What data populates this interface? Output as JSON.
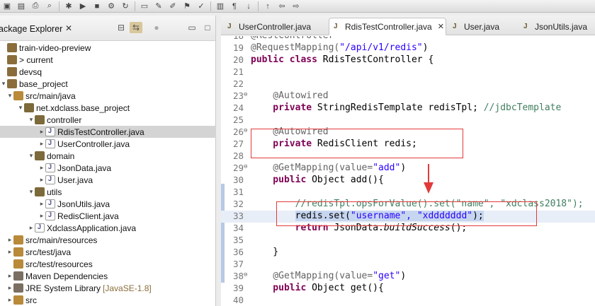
{
  "toolbar": {
    "icons": [
      "save-icon",
      "save-all-icon",
      "print-icon",
      "search-icon",
      "debug-icon",
      "run-icon",
      "stop-icon",
      "build-icon",
      "refresh-icon",
      "open-folder-icon",
      "edit-icon",
      "pencil-icon",
      "filter-icon",
      "highlight-icon",
      "layout-icon",
      "paragraph-icon",
      "navigate-down-icon",
      "navigate-up-icon",
      "back-icon",
      "forward-icon"
    ]
  },
  "explorer": {
    "title": "ackage Explorer",
    "close_glyph": "✕",
    "tree": [
      {
        "label": "train-video-preview",
        "indent": 0,
        "twisty": "",
        "icon": "project",
        "suffix": ""
      },
      {
        "label": "> current",
        "indent": 0,
        "twisty": "",
        "icon": "project",
        "suffix": ""
      },
      {
        "label": "devsq",
        "indent": 0,
        "twisty": "",
        "icon": "project",
        "suffix": ""
      },
      {
        "label": "base_project",
        "indent": 0,
        "twisty": "▾",
        "icon": "project",
        "suffix": ""
      },
      {
        "label": "src/main/java",
        "indent": 1,
        "twisty": "▾",
        "icon": "folder-src",
        "suffix": ""
      },
      {
        "label": "net.xdclass.base_project",
        "indent": 2,
        "twisty": "▾",
        "icon": "pkg",
        "suffix": ""
      },
      {
        "label": "controller",
        "indent": 3,
        "twisty": "▾",
        "icon": "pkg",
        "suffix": ""
      },
      {
        "label": "RdisTestController.java",
        "indent": 4,
        "twisty": "▸",
        "icon": "java",
        "suffix": "",
        "selected": true
      },
      {
        "label": "UserController.java",
        "indent": 4,
        "twisty": "▸",
        "icon": "java",
        "suffix": ""
      },
      {
        "label": "domain",
        "indent": 3,
        "twisty": "▾",
        "icon": "pkg",
        "suffix": ""
      },
      {
        "label": "JsonData.java",
        "indent": 4,
        "twisty": "▸",
        "icon": "java",
        "suffix": ""
      },
      {
        "label": "User.java",
        "indent": 4,
        "twisty": "▸",
        "icon": "java",
        "suffix": ""
      },
      {
        "label": "utils",
        "indent": 3,
        "twisty": "▾",
        "icon": "pkg",
        "suffix": ""
      },
      {
        "label": "JsonUtils.java",
        "indent": 4,
        "twisty": "▸",
        "icon": "java",
        "suffix": ""
      },
      {
        "label": "RedisClient.java",
        "indent": 4,
        "twisty": "▸",
        "icon": "java",
        "suffix": ""
      },
      {
        "label": "XdclassApplication.java",
        "indent": 3,
        "twisty": "▸",
        "icon": "java",
        "suffix": ""
      },
      {
        "label": "src/main/resources",
        "indent": 1,
        "twisty": "▸",
        "icon": "folder-src",
        "suffix": ""
      },
      {
        "label": "src/test/java",
        "indent": 1,
        "twisty": "▸",
        "icon": "folder-src",
        "suffix": ""
      },
      {
        "label": "src/test/resources",
        "indent": 1,
        "twisty": "",
        "icon": "folder-src",
        "suffix": ""
      },
      {
        "label": "Maven Dependencies",
        "indent": 1,
        "twisty": "▸",
        "icon": "lib",
        "suffix": ""
      },
      {
        "label": "JRE System Library",
        "indent": 1,
        "twisty": "▸",
        "icon": "lib",
        "suffix": "[JavaSE-1.8]"
      },
      {
        "label": "src",
        "indent": 1,
        "twisty": "▸",
        "icon": "folder-src",
        "suffix": ""
      }
    ]
  },
  "editor": {
    "tabs": [
      {
        "label": "UserController.java",
        "active": false,
        "close": ""
      },
      {
        "label": "RdisTestController.java",
        "active": true,
        "close": "✕"
      },
      {
        "label": "User.java",
        "active": false,
        "close": ""
      },
      {
        "label": "JsonUtils.java",
        "active": false,
        "close": ""
      }
    ],
    "lines": [
      {
        "n": "18",
        "fold": "",
        "hl": false,
        "parts": [
          {
            "c": "ann",
            "t": "@RestController"
          }
        ]
      },
      {
        "n": "19",
        "fold": "",
        "hl": false,
        "parts": [
          {
            "c": "ann",
            "t": "@RequestMapping("
          },
          {
            "c": "str",
            "t": "\"/api/v1/redis\""
          },
          {
            "c": "",
            "t": ")"
          }
        ]
      },
      {
        "n": "20",
        "fold": "",
        "hl": false,
        "parts": [
          {
            "c": "kw",
            "t": "public class "
          },
          {
            "c": "",
            "t": "RdisTestController {"
          }
        ]
      },
      {
        "n": "21",
        "fold": "",
        "hl": false,
        "parts": []
      },
      {
        "n": "22",
        "fold": "",
        "hl": false,
        "parts": []
      },
      {
        "n": "23",
        "fold": "⊖",
        "hl": false,
        "parts": [
          {
            "c": "ann",
            "t": "    @Autowired"
          }
        ]
      },
      {
        "n": "24",
        "fold": "",
        "hl": false,
        "parts": [
          {
            "c": "kw",
            "t": "    private "
          },
          {
            "c": "",
            "t": "StringRedisTemplate redisTpl; "
          },
          {
            "c": "cmt",
            "t": "//jdbcTemplate"
          }
        ]
      },
      {
        "n": "25",
        "fold": "",
        "hl": false,
        "parts": []
      },
      {
        "n": "26",
        "fold": "⊖",
        "hl": false,
        "parts": [
          {
            "c": "ann",
            "t": "    @Autowired"
          }
        ]
      },
      {
        "n": "27",
        "fold": "",
        "hl": false,
        "parts": [
          {
            "c": "kw",
            "t": "    private "
          },
          {
            "c": "",
            "t": "RedisClient redis;"
          }
        ]
      },
      {
        "n": "28",
        "fold": "",
        "hl": false,
        "parts": []
      },
      {
        "n": "29",
        "fold": "⊖",
        "hl": false,
        "parts": [
          {
            "c": "ann",
            "t": "    @GetMapping(value="
          },
          {
            "c": "str",
            "t": "\"add\""
          },
          {
            "c": "",
            "t": ")"
          }
        ]
      },
      {
        "n": "30",
        "fold": "",
        "hl": false,
        "parts": [
          {
            "c": "kw",
            "t": "    public "
          },
          {
            "c": "",
            "t": "Object add(){"
          }
        ]
      },
      {
        "n": "31",
        "fold": "",
        "hl": false,
        "parts": []
      },
      {
        "n": "32",
        "fold": "",
        "hl": false,
        "parts": [
          {
            "c": "cmt",
            "t": "        //redisTpl.opsForValue().set(\"name\", \"xdclass2018\");"
          }
        ]
      },
      {
        "n": "33",
        "fold": "",
        "hl": true,
        "parts": [
          {
            "c": "",
            "t": "        "
          },
          {
            "c": "sel",
            "t": "redis.set("
          },
          {
            "c": "sel str",
            "t": "\"username\", \"xddddddd\""
          },
          {
            "c": "sel",
            "t": ");"
          }
        ]
      },
      {
        "n": "34",
        "fold": "",
        "hl": false,
        "parts": [
          {
            "c": "kw",
            "t": "        return "
          },
          {
            "c": "",
            "t": "JsonData."
          },
          {
            "c": "ital",
            "t": "buildSuccess"
          },
          {
            "c": "",
            "t": "();"
          }
        ]
      },
      {
        "n": "35",
        "fold": "",
        "hl": false,
        "parts": []
      },
      {
        "n": "36",
        "fold": "",
        "hl": false,
        "parts": [
          {
            "c": "",
            "t": "    }"
          }
        ]
      },
      {
        "n": "37",
        "fold": "",
        "hl": false,
        "parts": []
      },
      {
        "n": "38",
        "fold": "⊖",
        "hl": false,
        "parts": [
          {
            "c": "ann",
            "t": "    @GetMapping(value="
          },
          {
            "c": "str",
            "t": "\"get\""
          },
          {
            "c": "",
            "t": ")"
          }
        ]
      },
      {
        "n": "39",
        "fold": "",
        "hl": false,
        "parts": [
          {
            "c": "kw",
            "t": "    public "
          },
          {
            "c": "",
            "t": "Object get(){"
          }
        ]
      },
      {
        "n": "40",
        "fold": "",
        "hl": false,
        "parts": []
      }
    ]
  },
  "annotation_color": "#e23a3a"
}
